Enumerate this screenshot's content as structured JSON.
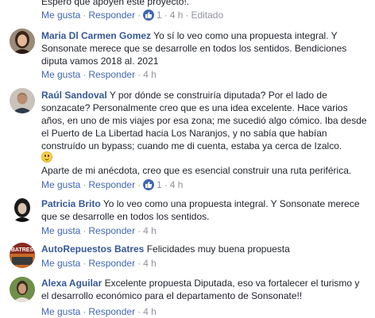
{
  "top": {
    "text": "Espero que apoyen este proyecto!.",
    "like": "Me gusta",
    "reply": "Responder",
    "likes": "1",
    "time": "4 h",
    "edited": "Editado"
  },
  "comments": [
    {
      "author": "Maria Dl Carmen Gomez",
      "text": "Yo sí lo veo como una propuesta integral. Y Sonsonate merece que se desarrolle en todos los sentidos. Bendiciones diputa vamos 2018 al. 2021",
      "like": "Me gusta",
      "reply": "Responder",
      "time": "4 h"
    },
    {
      "author": "Raúl Sandoval",
      "text": "Y por dónde se construiría diputada? Por el lado de sonzacate? Personalmente creo que es una idea excelente. Hace varios años, en uno de mis viajes por esa zona; me sucedió algo cómico. Iba desde el Puerto de La Libertad hacia Los Naranjos, y no sabía que habían construído un bypass; cuando me di cuenta, estaba ya cerca de Izalco.",
      "text2": "Aparte de mi anécdota, creo que es esencial construir una ruta periférica.",
      "like": "Me gusta",
      "reply": "Responder",
      "likes": "1",
      "time": "4 h"
    },
    {
      "author": "Patricia Brito",
      "text": "Yo lo veo como una propuesta integral. Y Sonsonate merece que se desarrolle en todos los sentidos.",
      "like": "Me gusta",
      "reply": "Responder",
      "time": "4 h"
    },
    {
      "author": "AutoRepuestos Batres",
      "text": "Felicidades muy buena propuesta",
      "like": "Me gusta",
      "reply": "Responder",
      "time": "4 h"
    },
    {
      "author": "Alexa Aguilar",
      "text": "Excelente propuesta Diputada, eso va fortalecer el turismo y el desarrollo económico para el departamento de Sonsonate!!",
      "like": "Me gusta",
      "reply": "Responder",
      "time": "4 h"
    }
  ],
  "avatar_logo_text": "BATRES"
}
